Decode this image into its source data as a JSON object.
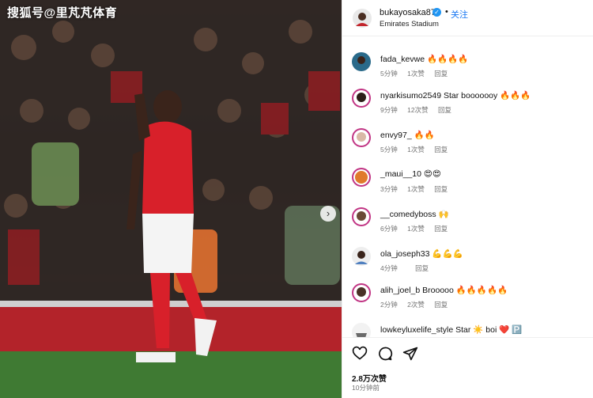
{
  "watermark": "搜狐号@里芃芃体育",
  "post": {
    "username": "bukayosaka87",
    "dot": "•",
    "follow_label": "关注",
    "location": "Emirates Stadium",
    "likes": "2.8万次赞",
    "time_ago": "10分钟前"
  },
  "comments": [
    {
      "user": "fada_kevwe",
      "text": "",
      "emojis": "🔥🔥🔥🔥",
      "time": "5分钟",
      "likes": "1次赞",
      "reply": "回复"
    },
    {
      "user": "nyarkisumo2549",
      "text": "Star booooooy",
      "emojis": "🔥🔥🔥",
      "time": "9分钟",
      "likes": "12次赞",
      "reply": "回复"
    },
    {
      "user": "envy97_",
      "text": "",
      "emojis": "🔥🔥",
      "time": "5分钟",
      "likes": "1次赞",
      "reply": "回复"
    },
    {
      "user": "_maui__10",
      "text": "",
      "emojis": "😍😍",
      "time": "3分钟",
      "likes": "1次赞",
      "reply": "回复"
    },
    {
      "user": "__comedyboss",
      "text": "",
      "emojis": "🙌",
      "time": "6分钟",
      "likes": "1次赞",
      "reply": "回复"
    },
    {
      "user": "ola_joseph33",
      "text": "",
      "emojis": "💪💪💪",
      "time": "4分钟",
      "likes": "",
      "reply": "回复"
    },
    {
      "user": "alih_joel_b",
      "text": "Brooooo",
      "emojis": "🔥🔥🔥🔥🔥",
      "time": "2分钟",
      "likes": "2次赞",
      "reply": "回复"
    },
    {
      "user": "lowkeyluxelife_style",
      "text": "Star ☀️ boi ❤️ 🅿️",
      "emojis": "",
      "time": "",
      "likes": "",
      "reply": ""
    }
  ],
  "icons": {
    "like": "heart-icon",
    "comment": "comment-icon",
    "share": "send-icon",
    "next": "chevron-right-icon"
  },
  "colors": {
    "follow": "#1877f2",
    "verified": "#2196f3",
    "arsenal_red": "#d8202a"
  }
}
